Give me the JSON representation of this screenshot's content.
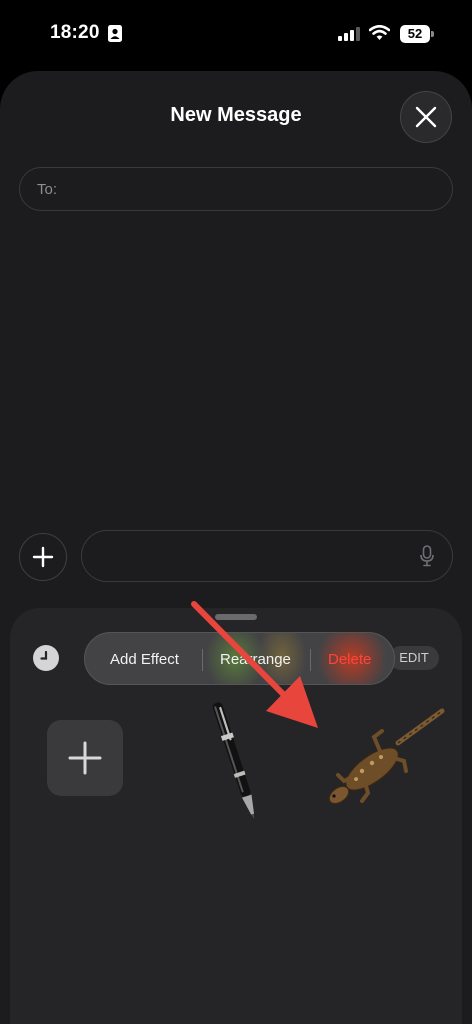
{
  "status_bar": {
    "time": "18:20",
    "battery": "52"
  },
  "sheet": {
    "title": "New Message",
    "to_label": "To:"
  },
  "compose": {
    "message_value": ""
  },
  "sticker_tray": {
    "edit_label": "EDIT",
    "context_menu": {
      "add_effect": "Add Effect",
      "rearrange": "Rearrange",
      "delete": "Delete"
    },
    "stickers": [
      "pen",
      "gecko"
    ]
  },
  "colors": {
    "sheet_bg": "#1c1c1e",
    "tray_bg": "#252527",
    "delete_red": "#ff453a",
    "arrow_red": "#e8453c"
  }
}
